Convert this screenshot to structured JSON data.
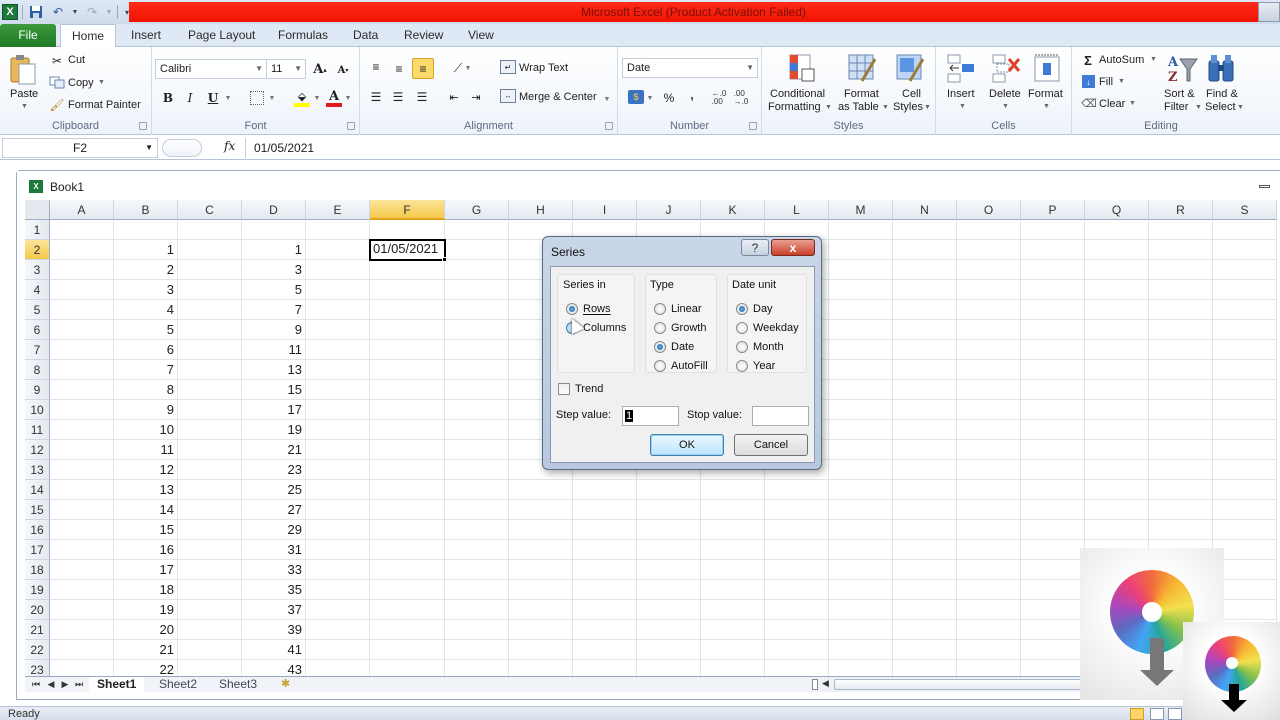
{
  "window": {
    "title": "Microsoft Excel (Product Activation Failed)",
    "title_bar_color": "#f01400"
  },
  "quick_access": {
    "icons": [
      "excel-logo-icon",
      "save-icon",
      "undo-icon",
      "redo-icon",
      "customize-qat-icon"
    ]
  },
  "menu_tabs": [
    {
      "label": "File",
      "active": false
    },
    {
      "label": "Home",
      "active": true
    },
    {
      "label": "Insert",
      "active": false
    },
    {
      "label": "Page Layout",
      "active": false
    },
    {
      "label": "Formulas",
      "active": false
    },
    {
      "label": "Data",
      "active": false
    },
    {
      "label": "Review",
      "active": false
    },
    {
      "label": "View",
      "active": false
    }
  ],
  "ribbon": {
    "clipboard": {
      "label": "Clipboard",
      "paste": "Paste",
      "cut": "Cut",
      "copy": "Copy",
      "format_painter": "Format Painter"
    },
    "font": {
      "label": "Font",
      "font_name": "Calibri",
      "font_size": "11",
      "bold": "B",
      "italic": "I",
      "underline": "U"
    },
    "alignment": {
      "label": "Alignment",
      "wrap_text": "Wrap Text",
      "merge_center": "Merge & Center"
    },
    "number": {
      "label": "Number",
      "format": "Date",
      "percent": "%",
      "comma": ","
    },
    "styles": {
      "label": "Styles",
      "conditional_formatting_1": "Conditional",
      "conditional_formatting_2": "Formatting",
      "format_as_table_1": "Format",
      "format_as_table_2": "as Table",
      "cell_styles_1": "Cell",
      "cell_styles_2": "Styles"
    },
    "cells": {
      "label": "Cells",
      "insert": "Insert",
      "delete": "Delete",
      "format": "Format"
    },
    "editing": {
      "label": "Editing",
      "autosum": "AutoSum",
      "fill": "Fill",
      "clear": "Clear",
      "sort_filter_1": "Sort &",
      "sort_filter_2": "Filter",
      "find_select_1": "Find &",
      "find_select_2": "Select"
    }
  },
  "formula_bar": {
    "name_box": "F2",
    "fx": "fx",
    "value": "01/05/2021"
  },
  "workbook": {
    "name": "Book1"
  },
  "grid": {
    "columns": [
      "A",
      "B",
      "C",
      "D",
      "E",
      "F",
      "G",
      "H",
      "I",
      "J",
      "K",
      "L",
      "M",
      "N",
      "O",
      "P",
      "Q",
      "R",
      "S"
    ],
    "selected_column": "F",
    "selected_row": 2,
    "rows": [
      {
        "row": 1,
        "B": "",
        "D": ""
      },
      {
        "row": 2,
        "B": "1",
        "D": "1"
      },
      {
        "row": 3,
        "B": "2",
        "D": "3"
      },
      {
        "row": 4,
        "B": "3",
        "D": "5"
      },
      {
        "row": 5,
        "B": "4",
        "D": "7"
      },
      {
        "row": 6,
        "B": "5",
        "D": "9"
      },
      {
        "row": 7,
        "B": "6",
        "D": "11"
      },
      {
        "row": 8,
        "B": "7",
        "D": "13"
      },
      {
        "row": 9,
        "B": "8",
        "D": "15"
      },
      {
        "row": 10,
        "B": "9",
        "D": "17"
      },
      {
        "row": 11,
        "B": "10",
        "D": "19"
      },
      {
        "row": 12,
        "B": "11",
        "D": "21"
      },
      {
        "row": 13,
        "B": "12",
        "D": "23"
      },
      {
        "row": 14,
        "B": "13",
        "D": "25"
      },
      {
        "row": 15,
        "B": "14",
        "D": "27"
      },
      {
        "row": 16,
        "B": "15",
        "D": "29"
      },
      {
        "row": 17,
        "B": "16",
        "D": "31"
      },
      {
        "row": 18,
        "B": "17",
        "D": "33"
      },
      {
        "row": 19,
        "B": "18",
        "D": "35"
      },
      {
        "row": 20,
        "B": "19",
        "D": "37"
      },
      {
        "row": 21,
        "B": "20",
        "D": "39"
      },
      {
        "row": 22,
        "B": "21",
        "D": "41"
      },
      {
        "row": 23,
        "B": "22",
        "D": "43"
      }
    ],
    "active_cell_value": "01/05/2021"
  },
  "sheets": [
    {
      "label": "Sheet1",
      "active": true
    },
    {
      "label": "Sheet2",
      "active": false
    },
    {
      "label": "Sheet3",
      "active": false
    }
  ],
  "status": {
    "ready": "Ready"
  },
  "dialog": {
    "title": "Series",
    "help": "?",
    "close": "x",
    "series_in": {
      "legend": "Series in",
      "options": [
        {
          "label": "Rows",
          "checked": true
        },
        {
          "label": "Columns",
          "checked": false
        }
      ]
    },
    "type": {
      "legend": "Type",
      "options": [
        {
          "label": "Linear",
          "checked": false
        },
        {
          "label": "Growth",
          "checked": false
        },
        {
          "label": "Date",
          "checked": true
        },
        {
          "label": "AutoFill",
          "checked": false
        }
      ]
    },
    "date_unit": {
      "legend": "Date unit",
      "options": [
        {
          "label": "Day",
          "checked": true
        },
        {
          "label": "Weekday",
          "checked": false
        },
        {
          "label": "Month",
          "checked": false
        },
        {
          "label": "Year",
          "checked": false
        }
      ]
    },
    "trend": {
      "label": "Trend",
      "checked": false
    },
    "step_value": {
      "label": "Step value:",
      "value": "1"
    },
    "stop_value": {
      "label": "Stop value:",
      "value": ""
    },
    "ok": "OK",
    "cancel": "Cancel"
  }
}
